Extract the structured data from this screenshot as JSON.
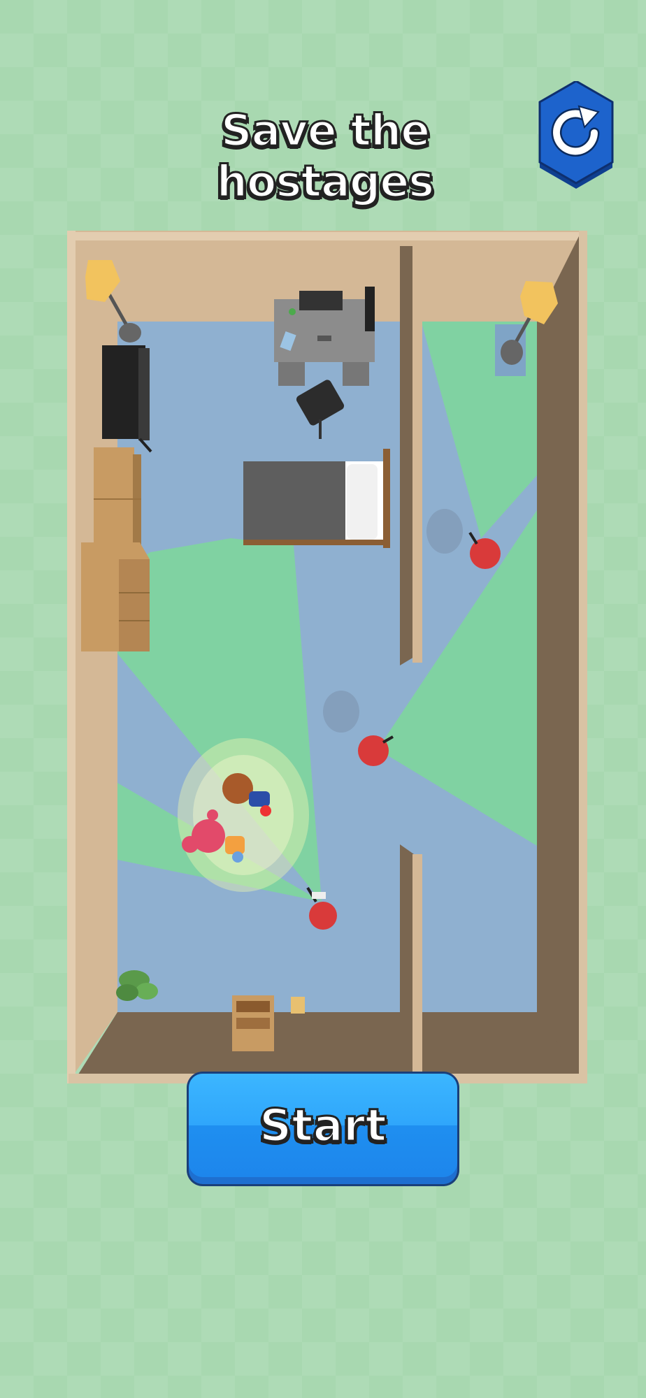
{
  "level": {
    "title": "Save the hostages"
  },
  "controls": {
    "start_label": "Start",
    "restart_icon": "restart-icon"
  },
  "colors": {
    "background": "#a8d8b0",
    "floor": "#8fb0d0",
    "wall_top": "#d4b896",
    "wall_side": "#7a6650",
    "vision_cone": "#7ed89a",
    "enemy": "#d93a3a",
    "button": "#2fa6fb",
    "restart_button": "#1a5fc8"
  },
  "characters": {
    "hostages": [
      "hostage-boy",
      "hostage-girl"
    ],
    "guards": [
      "guard-top-right",
      "guard-middle",
      "guard-bottom"
    ]
  }
}
